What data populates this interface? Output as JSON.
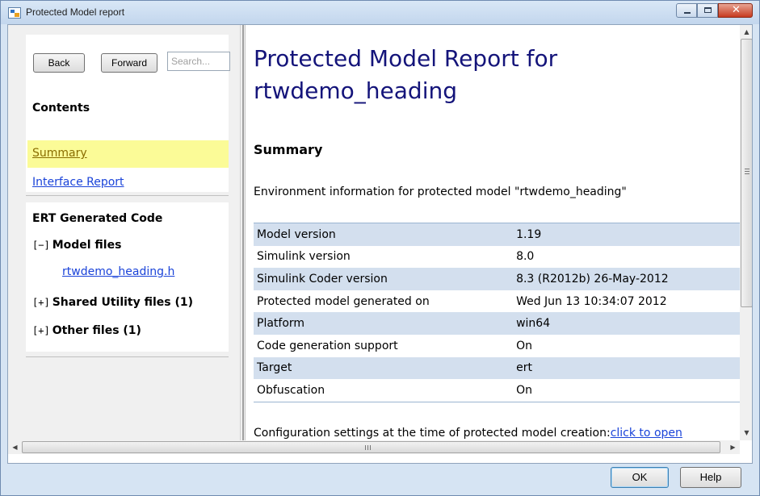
{
  "window": {
    "title": "Protected Model report",
    "controls": {
      "minimize": "minimize",
      "maximize": "maximize",
      "close": "✕"
    }
  },
  "nav": {
    "back_label": "Back",
    "forward_label": "Forward",
    "search_placeholder": "Search...",
    "contents_heading": "Contents",
    "links": [
      {
        "label": "Summary",
        "selected": true
      },
      {
        "label": "Interface Report",
        "selected": false
      }
    ]
  },
  "code": {
    "heading": "ERT Generated Code",
    "groups": [
      {
        "toggle": "[−]",
        "label": "Model files",
        "children": [
          "rtwdemo_heading.h"
        ]
      },
      {
        "toggle": "[+]",
        "label": "Shared Utility files (1)",
        "children": []
      },
      {
        "toggle": "[+]",
        "label": "Other files (1)",
        "children": []
      }
    ]
  },
  "report": {
    "title": "Protected Model Report for rtwdemo_heading",
    "summary_heading": "Summary",
    "env_info": "Environment information for protected model \"rtwdemo_heading\"",
    "rows": [
      {
        "label": "Model version",
        "value": "1.19"
      },
      {
        "label": "Simulink version",
        "value": "8.0"
      },
      {
        "label": "Simulink Coder version",
        "value": "8.3 (R2012b) 26-May-2012"
      },
      {
        "label": "Protected model generated on",
        "value": "Wed Jun 13 10:34:07 2012"
      },
      {
        "label": "Platform",
        "value": "win64"
      },
      {
        "label": "Code generation support",
        "value": "On"
      },
      {
        "label": "Target",
        "value": "ert"
      },
      {
        "label": "Obfuscation",
        "value": "On"
      }
    ],
    "config_text": "Configuration settings at the time of protected model creation:",
    "config_link": "click to open"
  },
  "footer": {
    "ok_label": "OK",
    "help_label": "Help"
  },
  "colors": {
    "title": "#14147a",
    "link": "#1a43d9",
    "highlight": "#fbfb97",
    "row_alt": "#d3dfee"
  }
}
